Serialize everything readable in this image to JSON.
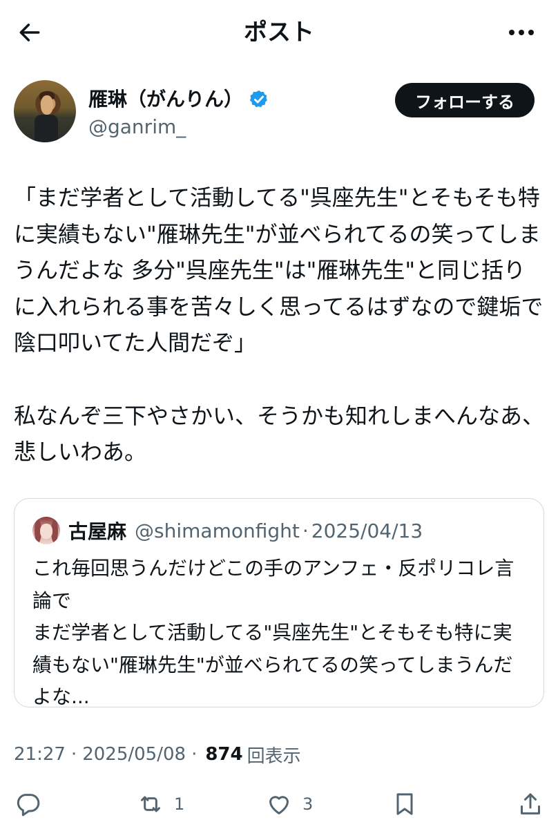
{
  "header": {
    "title": "ポスト",
    "back_icon": "back-arrow-icon",
    "more_icon": "more-dots-icon"
  },
  "author": {
    "name": "雁琳（がんりん）",
    "handle": "@ganrim_",
    "verified": true,
    "verified_color": "#1d9bf0"
  },
  "follow_button": {
    "label": "フォローする"
  },
  "tweet": {
    "text": "「まだ学者として活動してる\"呉座先生\"とそもそも特に実績もない\"雁琳先生\"が並べられてるの笑ってしまうんだよな 多分\"呉座先生\"は\"雁琳先生\"と同じ括りに入れられる事を苦々しく思ってるはずなので鍵垢で陰口叩いてた人間だぞ」\n\n私なんぞ三下やさかい、そうかも知れしまへんなあ、悲しいわあ。"
  },
  "quote": {
    "name": "古屋麻",
    "handle": "@shimamonfight",
    "separator": "·",
    "date": "2025/04/13",
    "text": "これ毎回思うんだけどこの手のアンフェ・反ポリコレ言論で\nまだ学者として活動してる\"呉座先生\"とそもそも特に実績もない\"雁琳先生\"が並べられてるの笑ってしまうんだよな..."
  },
  "meta": {
    "time": "21:27",
    "separator1": "·",
    "date": "2025/05/08",
    "separator2": "·",
    "views": "874",
    "views_label": "回表示"
  },
  "actions": {
    "reply": {
      "icon": "reply-icon",
      "count": ""
    },
    "repost": {
      "icon": "repost-icon",
      "count": "1"
    },
    "like": {
      "icon": "heart-icon",
      "count": "3"
    },
    "bookmark": {
      "icon": "bookmark-icon",
      "count": ""
    },
    "share": {
      "icon": "share-icon",
      "count": ""
    }
  },
  "colors": {
    "text": "#0f1419",
    "secondary": "#536471",
    "border": "#cfd9de",
    "follow_bg": "#0f1419"
  }
}
